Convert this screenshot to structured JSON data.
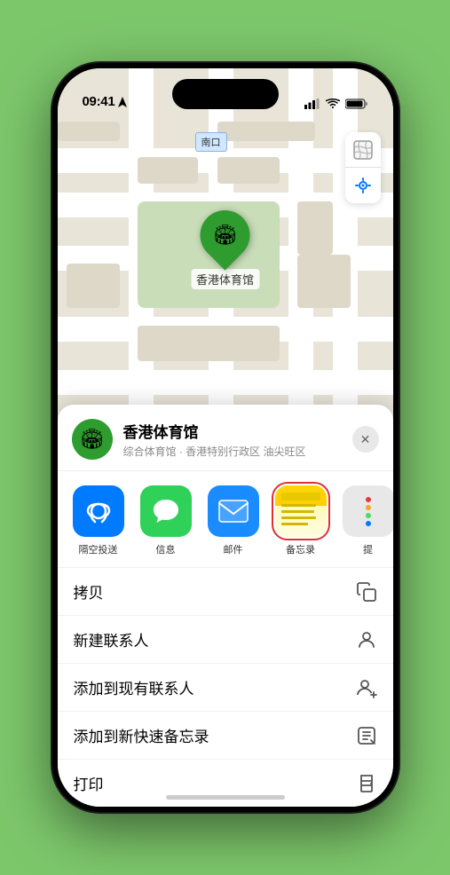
{
  "status_bar": {
    "time": "09:41",
    "location_arrow": true
  },
  "map": {
    "label": "南口",
    "controls": [
      "map-icon",
      "location-icon"
    ]
  },
  "pin": {
    "label": "香港体育馆",
    "emoji": "🏟"
  },
  "sheet": {
    "location_name": "香港体育馆",
    "location_sub": "综合体育馆 · 香港特别行政区 油尖旺区",
    "close_label": "✕",
    "share_items": [
      {
        "id": "airdrop",
        "label": "隔空投送",
        "type": "airdrop"
      },
      {
        "id": "messages",
        "label": "信息",
        "type": "messages"
      },
      {
        "id": "mail",
        "label": "邮件",
        "type": "mail"
      },
      {
        "id": "notes",
        "label": "备忘录",
        "type": "notes"
      },
      {
        "id": "more",
        "label": "提",
        "type": "more"
      }
    ],
    "menu_items": [
      {
        "id": "copy",
        "label": "拷贝",
        "icon": "📋"
      },
      {
        "id": "new-contact",
        "label": "新建联系人",
        "icon": "👤"
      },
      {
        "id": "add-contact",
        "label": "添加到现有联系人",
        "icon": "👤+"
      },
      {
        "id": "add-notes",
        "label": "添加到新快速备忘录",
        "icon": "📝"
      },
      {
        "id": "print",
        "label": "打印",
        "icon": "🖨"
      }
    ]
  }
}
